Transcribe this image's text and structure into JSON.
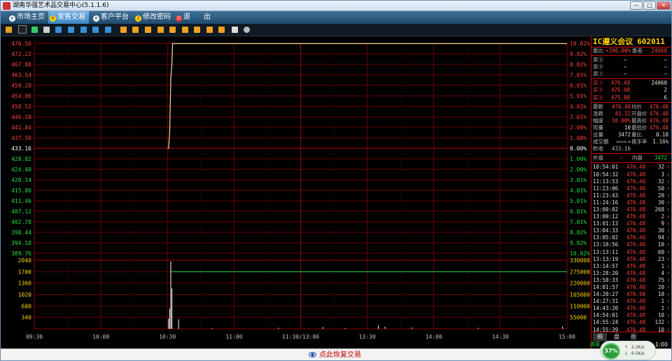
{
  "window": {
    "title": "湖南华强艺术品交易中心(5.1.1.6)",
    "buttons": [
      "—",
      "□",
      "✕"
    ]
  },
  "nav": {
    "items": [
      {
        "label": "市场主页",
        "icon": "home-icon"
      },
      {
        "label": "发售交易",
        "icon": "yen-icon"
      },
      {
        "label": "客户平台",
        "icon": "user-icon"
      },
      {
        "label": "修改密码",
        "icon": "key-icon"
      },
      {
        "label": "退",
        "icon": "power-icon"
      },
      {
        "label": "出",
        "icon": ""
      }
    ],
    "active_index": 1
  },
  "toolbar": {
    "icons": [
      "bar-chart-icon",
      "line-chart-icon",
      "candle-icon",
      "calendar-icon",
      "tool-1-icon",
      "tool-2-icon",
      "tool-3-icon",
      "tool-4-icon",
      "tool-5-icon",
      "tool-6-icon",
      "tool-7-icon",
      "tool-8-icon",
      "tool-9-icon",
      "tool-10-icon",
      "tool-11-icon",
      "tool-12-icon",
      "tool-13-icon",
      "tool-14-icon",
      "tool-15-icon",
      "settings-icon"
    ]
  },
  "colors": {
    "up": "#ff4040",
    "down": "#20e040",
    "grid": "#8b0000",
    "price_line": "#ffffff",
    "avg_line": "#ffd200",
    "volume": "#ffffff",
    "volume_line": "#20e040"
  },
  "chart_data": [
    {
      "type": "line",
      "name": "intraday-price",
      "y_labels_left": [
        "476.56",
        "472.22",
        "467.88",
        "463.54",
        "459.20",
        "454.86",
        "450.52",
        "446.18",
        "441.84",
        "437.50",
        "433.16",
        "428.82",
        "424.48",
        "420.14",
        "415.80",
        "411.46",
        "407.12",
        "402.78",
        "398.44",
        "394.10",
        "389.76"
      ],
      "y_labels_right": [
        "10.02%",
        "9.02%",
        "8.02%",
        "7.01%",
        "6.01%",
        "5.01%",
        "4.01%",
        "3.01%",
        "2.00%",
        "1.00%",
        "0.00%",
        "1.00%",
        "2.00%",
        "3.01%",
        "4.01%",
        "5.01%",
        "6.01%",
        "7.01%",
        "8.02%",
        "9.02%",
        "10.02%"
      ],
      "ylim": [
        389.76,
        476.56
      ],
      "prev_close": 433.16,
      "x_ticks": [
        "09:30",
        "10:00",
        "10:30",
        "11:00",
        "11:30/13:00",
        "13:30",
        "14:00",
        "14:30",
        "15:00"
      ],
      "x_range_minutes": [
        0,
        240
      ],
      "series": [
        {
          "values_x": [
            60,
            60.5,
            61,
            61.5,
            62,
            62.3,
            240
          ],
          "values_y": [
            433.16,
            433.16,
            440,
            462,
            468,
            476.48,
            476.48
          ]
        }
      ]
    },
    {
      "type": "bar",
      "name": "intraday-volume",
      "y_labels_left": [
        "2040",
        "1700",
        "1360",
        "1020",
        "680",
        "340"
      ],
      "y_labels_right": [
        "330000",
        "275000",
        "220000",
        "165000",
        "110000",
        "55000"
      ],
      "ylim": [
        0,
        2040
      ],
      "bars": [
        {
          "x": 60.5,
          "v": 300
        },
        {
          "x": 61,
          "v": 600
        },
        {
          "x": 61.5,
          "v": 2000
        },
        {
          "x": 62,
          "v": 1200
        },
        {
          "x": 65,
          "v": 280
        },
        {
          "x": 80,
          "v": 20
        },
        {
          "x": 110,
          "v": 30
        },
        {
          "x": 130,
          "v": 50
        },
        {
          "x": 140,
          "v": 20
        },
        {
          "x": 155,
          "v": 100
        },
        {
          "x": 158,
          "v": 60
        },
        {
          "x": 170,
          "v": 40
        },
        {
          "x": 200,
          "v": 30
        },
        {
          "x": 238,
          "v": 70
        }
      ],
      "cum_line": {
        "x": [
          61.5,
          240
        ],
        "y": [
          1700,
          1700
        ]
      }
    }
  ],
  "panel": {
    "name": "IC遵义会议",
    "code": "602011",
    "ratio": {
      "label": "委比",
      "value": "+100.00%",
      "diff_label": "委差",
      "diff_value": "24060"
    },
    "asks": [
      {
        "label": "卖③",
        "price": "—",
        "vol": "—"
      },
      {
        "label": "卖②",
        "price": "—",
        "vol": "—"
      },
      {
        "label": "卖①",
        "price": "—",
        "vol": "—"
      }
    ],
    "bids": [
      {
        "label": "买①",
        "price": "476.48",
        "vol": "24060"
      },
      {
        "label": "买②",
        "price": "476.00",
        "vol": "2"
      },
      {
        "label": "买③",
        "price": "475.00",
        "vol": "6"
      }
    ],
    "stats": [
      {
        "l1": "最新",
        "v1": "476.48",
        "l2": "均价",
        "v2": "476.48"
      },
      {
        "l1": "涨跌",
        "v1": "43.32",
        "l2": "开盘价",
        "v2": "476.48"
      },
      {
        "l1": "幅度",
        "v1": "10.00%",
        "l2": "最高价",
        "v2": "476.48"
      },
      {
        "l1": "现量",
        "v1": "10",
        "l2": "最低价",
        "v2": "476.48"
      },
      {
        "l1": "总量",
        "v1": "3472",
        "l2": "量比",
        "v2": "0.18"
      },
      {
        "l1": "成交额",
        "v1": "1654338.56",
        "l2": "换手率",
        "v2": "1.16%"
      },
      {
        "l1": "昨收",
        "v1": "433.16",
        "l2": "",
        "v2": ""
      }
    ],
    "outer": {
      "label": "外盘",
      "value": "—",
      "inner_label": "内盘",
      "inner_value": "3472"
    },
    "ticks": [
      {
        "t": "10:54:01",
        "p": "476.48",
        "v": "32"
      },
      {
        "t": "10:54:32",
        "p": "476.48",
        "v": "3"
      },
      {
        "t": "11:13:53",
        "p": "476.48",
        "v": "32"
      },
      {
        "t": "11:23:06",
        "p": "476.48",
        "v": "50"
      },
      {
        "t": "11:23:43",
        "p": "476.48",
        "v": "20"
      },
      {
        "t": "11:24:16",
        "p": "476.48",
        "v": "30"
      },
      {
        "t": "13:00:02",
        "p": "476.48",
        "v": "268"
      },
      {
        "t": "13:00:12",
        "p": "476.48",
        "v": "2"
      },
      {
        "t": "13:01:13",
        "p": "476.48",
        "v": "9"
      },
      {
        "t": "13:04:33",
        "p": "476.48",
        "v": "30"
      },
      {
        "t": "13:05:02",
        "p": "476.48",
        "v": "94"
      },
      {
        "t": "13:10:56",
        "p": "476.48",
        "v": "10"
      },
      {
        "t": "13:13:11",
        "p": "476.48",
        "v": "60"
      },
      {
        "t": "13:13:19",
        "p": "476.48",
        "v": "23"
      },
      {
        "t": "13:14:57",
        "p": "476.48",
        "v": "1"
      },
      {
        "t": "13:28:20",
        "p": "476.48",
        "v": "4"
      },
      {
        "t": "13:58:33",
        "p": "476.48",
        "v": "75"
      },
      {
        "t": "14:01:57",
        "p": "476.48",
        "v": "20"
      },
      {
        "t": "14:20:27",
        "p": "476.48",
        "v": "10"
      },
      {
        "t": "14:27:31",
        "p": "476.48",
        "v": "1"
      },
      {
        "t": "14:43:20",
        "p": "476.48",
        "v": "1"
      },
      {
        "t": "14:54:01",
        "p": "476.48",
        "v": "10"
      },
      {
        "t": "14:55:24",
        "p": "476.48",
        "v": "132"
      },
      {
        "t": "14:55:39",
        "p": "476.48",
        "v": "10"
      }
    ],
    "tabs": [
      "细",
      "盘",
      "图"
    ],
    "active_tab": 0
  },
  "status": {
    "resume_label": "点此恢复交易",
    "connection_label": "连接",
    "clock": "1:00",
    "net_percent": "37%",
    "net_up": "2.2K/s",
    "net_down": "6.5K/s"
  }
}
